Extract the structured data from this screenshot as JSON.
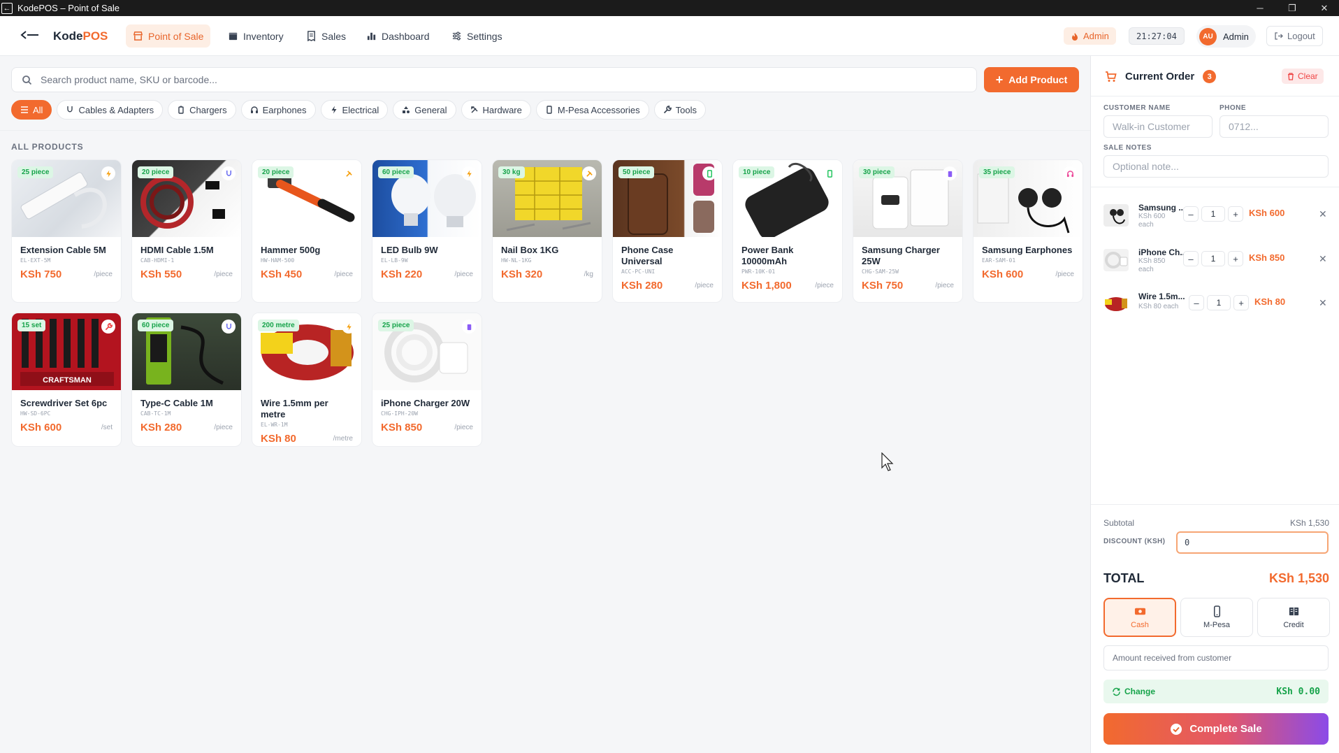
{
  "window": {
    "title": "KodePOS – Point of Sale"
  },
  "nav": {
    "brand_a": "Kode",
    "brand_b": "POS",
    "tabs": [
      {
        "label": "Point of Sale",
        "active": true,
        "icon": "store-icon"
      },
      {
        "label": "Inventory",
        "active": false,
        "icon": "box-icon"
      },
      {
        "label": "Sales",
        "active": false,
        "icon": "receipt-icon"
      },
      {
        "label": "Dashboard",
        "active": false,
        "icon": "bar-chart-icon"
      },
      {
        "label": "Settings",
        "active": false,
        "icon": "sliders-icon"
      }
    ],
    "role": "Admin",
    "clock": "21:27:04",
    "avatar_initials": "AU",
    "user": "Admin",
    "logout": "Logout"
  },
  "search": {
    "placeholder": "Search product name, SKU or barcode..."
  },
  "add_product": "Add Product",
  "categories": [
    "All",
    "Cables & Adapters",
    "Chargers",
    "Earphones",
    "Electrical",
    "General",
    "Hardware",
    "M-Pesa Accessories",
    "Tools"
  ],
  "section_title": "ALL PRODUCTS",
  "products": [
    {
      "name": "Extension Cable 5M",
      "sku": "EL-EXT-5M",
      "price": "KSh 750",
      "unit": "/piece",
      "stock": "25 piece",
      "icon": "bolt-icon",
      "icon_color": "#f59e0b"
    },
    {
      "name": "HDMI Cable 1.5M",
      "sku": "CAB-HDMI-1",
      "price": "KSh 550",
      "unit": "/piece",
      "stock": "20 piece",
      "icon": "cable-icon",
      "icon_color": "#6366f1"
    },
    {
      "name": "Hammer 500g",
      "sku": "HW-HAM-500",
      "price": "KSh 450",
      "unit": "/piece",
      "stock": "20 piece",
      "icon": "hammer-icon",
      "icon_color": "#f59e0b"
    },
    {
      "name": "LED Bulb 9W",
      "sku": "EL-LB-9W",
      "price": "KSh 220",
      "unit": "/piece",
      "stock": "60 piece",
      "icon": "bolt-icon",
      "icon_color": "#f59e0b"
    },
    {
      "name": "Nail Box 1KG",
      "sku": "HW-NL-1KG",
      "price": "KSh 320",
      "unit": "/kg",
      "stock": "30 kg",
      "icon": "hammer-icon",
      "icon_color": "#f59e0b"
    },
    {
      "name": "Phone Case Universal",
      "sku": "ACC-PC-UNI",
      "price": "KSh 280",
      "unit": "/piece",
      "stock": "50 piece",
      "icon": "phone-icon",
      "icon_color": "#22c55e"
    },
    {
      "name": "Power Bank 10000mAh",
      "sku": "PWR-10K-01",
      "price": "KSh 1,800",
      "unit": "/piece",
      "stock": "10 piece",
      "icon": "phone-icon",
      "icon_color": "#22c55e"
    },
    {
      "name": "Samsung Charger 25W",
      "sku": "CHG-SAM-25W",
      "price": "KSh 750",
      "unit": "/piece",
      "stock": "30 piece",
      "icon": "battery-icon",
      "icon_color": "#8b5cf6"
    },
    {
      "name": "Samsung Earphones",
      "sku": "EAR-SAM-01",
      "price": "KSh 600",
      "unit": "/piece",
      "stock": "35 piece",
      "icon": "headphones-icon",
      "icon_color": "#ec4899"
    },
    {
      "name": "Screwdriver Set 6pc",
      "sku": "HW-SD-6PC",
      "price": "KSh 600",
      "unit": "/set",
      "stock": "15 set",
      "icon": "wrench-icon",
      "icon_color": "#ef4444"
    },
    {
      "name": "Type-C Cable 1M",
      "sku": "CAB-TC-1M",
      "price": "KSh 280",
      "unit": "/piece",
      "stock": "60 piece",
      "icon": "cable-icon",
      "icon_color": "#6366f1"
    },
    {
      "name": "Wire 1.5mm per metre",
      "sku": "EL-WR-1M",
      "price": "KSh 80",
      "unit": "/metre",
      "stock": "200 metre",
      "icon": "bolt-icon",
      "icon_color": "#f59e0b"
    },
    {
      "name": "iPhone Charger 20W",
      "sku": "CHG-IPH-20W",
      "price": "KSh 850",
      "unit": "/piece",
      "stock": "25 piece",
      "icon": "battery-icon",
      "icon_color": "#8b5cf6"
    }
  ],
  "order": {
    "title": "Current Order",
    "count": "3",
    "clear": "Clear",
    "customer_label": "CUSTOMER NAME",
    "customer_placeholder": "Walk-in Customer",
    "phone_label": "PHONE",
    "phone_placeholder": "0712...",
    "notes_label": "SALE NOTES",
    "notes_placeholder": "Optional note...",
    "items": [
      {
        "name": "Samsung ...",
        "each_line1": "KSh 600",
        "each_line2": "each",
        "qty": "1",
        "total": "KSh 600"
      },
      {
        "name": "iPhone Ch...",
        "each_line1": "KSh 850",
        "each_line2": "each",
        "qty": "1",
        "total": "KSh 850"
      },
      {
        "name": "Wire 1.5m...",
        "each_line1": "KSh 80 each",
        "each_line2": "",
        "qty": "1",
        "total": "KSh 80"
      }
    ],
    "subtotal_label": "Subtotal",
    "subtotal": "KSh 1,530",
    "discount_label": "DISCOUNT (KSH)",
    "discount": "0",
    "total_label": "TOTAL",
    "total": "KSh 1,530",
    "payment_methods": [
      {
        "label": "Cash",
        "active": true,
        "icon": "cash-icon"
      },
      {
        "label": "M-Pesa",
        "active": false,
        "icon": "mobile-icon"
      },
      {
        "label": "Credit",
        "active": false,
        "icon": "credit-book-icon"
      }
    ],
    "amount_placeholder": "Amount received from customer",
    "change_label": "Change",
    "change_value": "KSh 0.00",
    "complete": "Complete Sale"
  },
  "colors": {
    "accent": "#f26a2e",
    "success": "#16a34a",
    "danger": "#ef4444"
  }
}
